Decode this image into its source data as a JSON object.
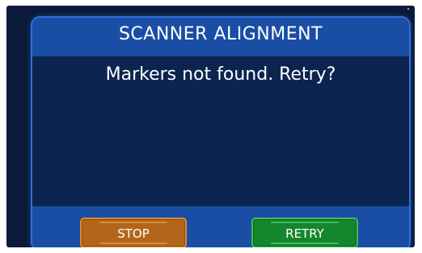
{
  "dialog": {
    "title": "SCANNER ALIGNMENT",
    "message": "Markers not found. Retry?"
  },
  "buttons": {
    "stop_label": "STOP",
    "retry_label": "RETRY"
  },
  "colors": {
    "screen_background": "#0b1a3a",
    "dialog_header": "#1a4ea5",
    "dialog_body": "#0c2450",
    "dialog_border": "#2f6fd6",
    "stop_button": "#b3661b",
    "retry_button": "#16862e"
  }
}
